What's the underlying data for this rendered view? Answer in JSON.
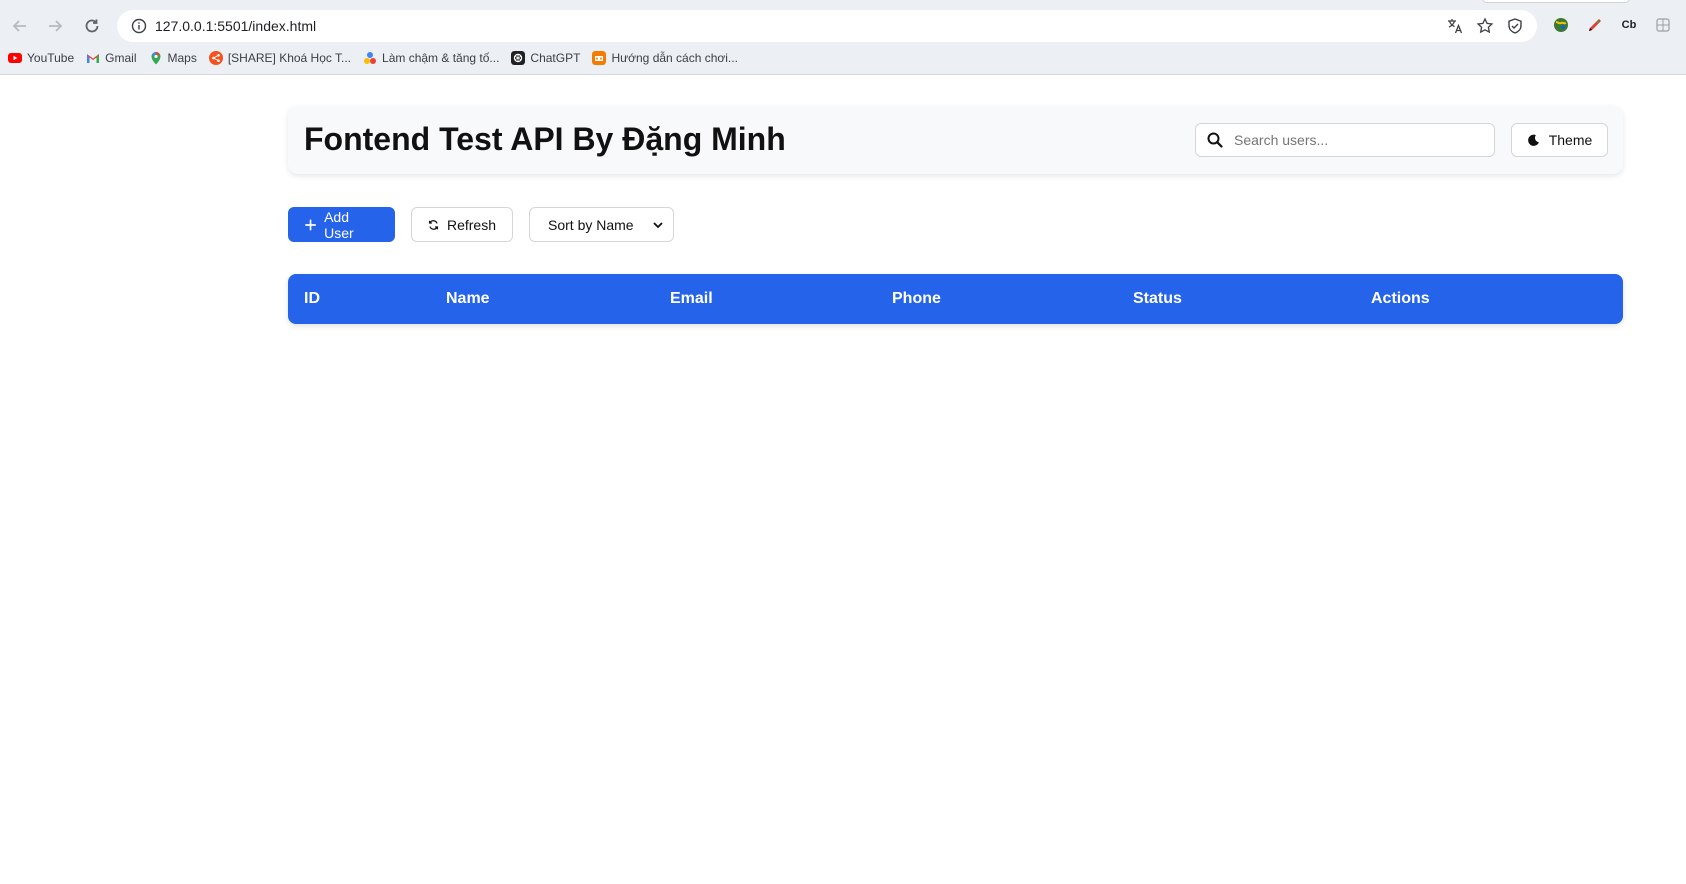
{
  "browser": {
    "url": "127.0.0.1:5501/index.html",
    "bookmarks": [
      {
        "label": "YouTube",
        "icon": "youtube-icon",
        "color": "#ff0000"
      },
      {
        "label": "Gmail",
        "icon": "gmail-icon",
        "color": "#ea4335"
      },
      {
        "label": "Maps",
        "icon": "maps-icon",
        "color": "#34a853"
      },
      {
        "label": "[SHARE] Khoá Học T...",
        "icon": "share-icon",
        "color": "#f4511e"
      },
      {
        "label": "Làm chậm & tăng tố...",
        "icon": "dots-icon",
        "color": "#fbbc04"
      },
      {
        "label": "ChatGPT",
        "icon": "chatgpt-icon",
        "color": "#202124"
      },
      {
        "label": "Hướng dẫn cách chơi...",
        "icon": "game-icon",
        "color": "#f57c00"
      }
    ],
    "extensions": [
      "globe-extension-icon",
      "pen-extension-icon",
      "Cb",
      "puzzle-extension-icon"
    ]
  },
  "header": {
    "title": "Fontend Test API By Đặng Minh",
    "search_placeholder": "Search users...",
    "theme_label": "Theme"
  },
  "toolbar": {
    "add_label": "Add User",
    "refresh_label": "Refresh",
    "sort_selected": "Sort by Name"
  },
  "table": {
    "columns": [
      "ID",
      "Name",
      "Email",
      "Phone",
      "Status",
      "Actions"
    ],
    "rows": []
  },
  "colors": {
    "accent": "#2563eb"
  }
}
